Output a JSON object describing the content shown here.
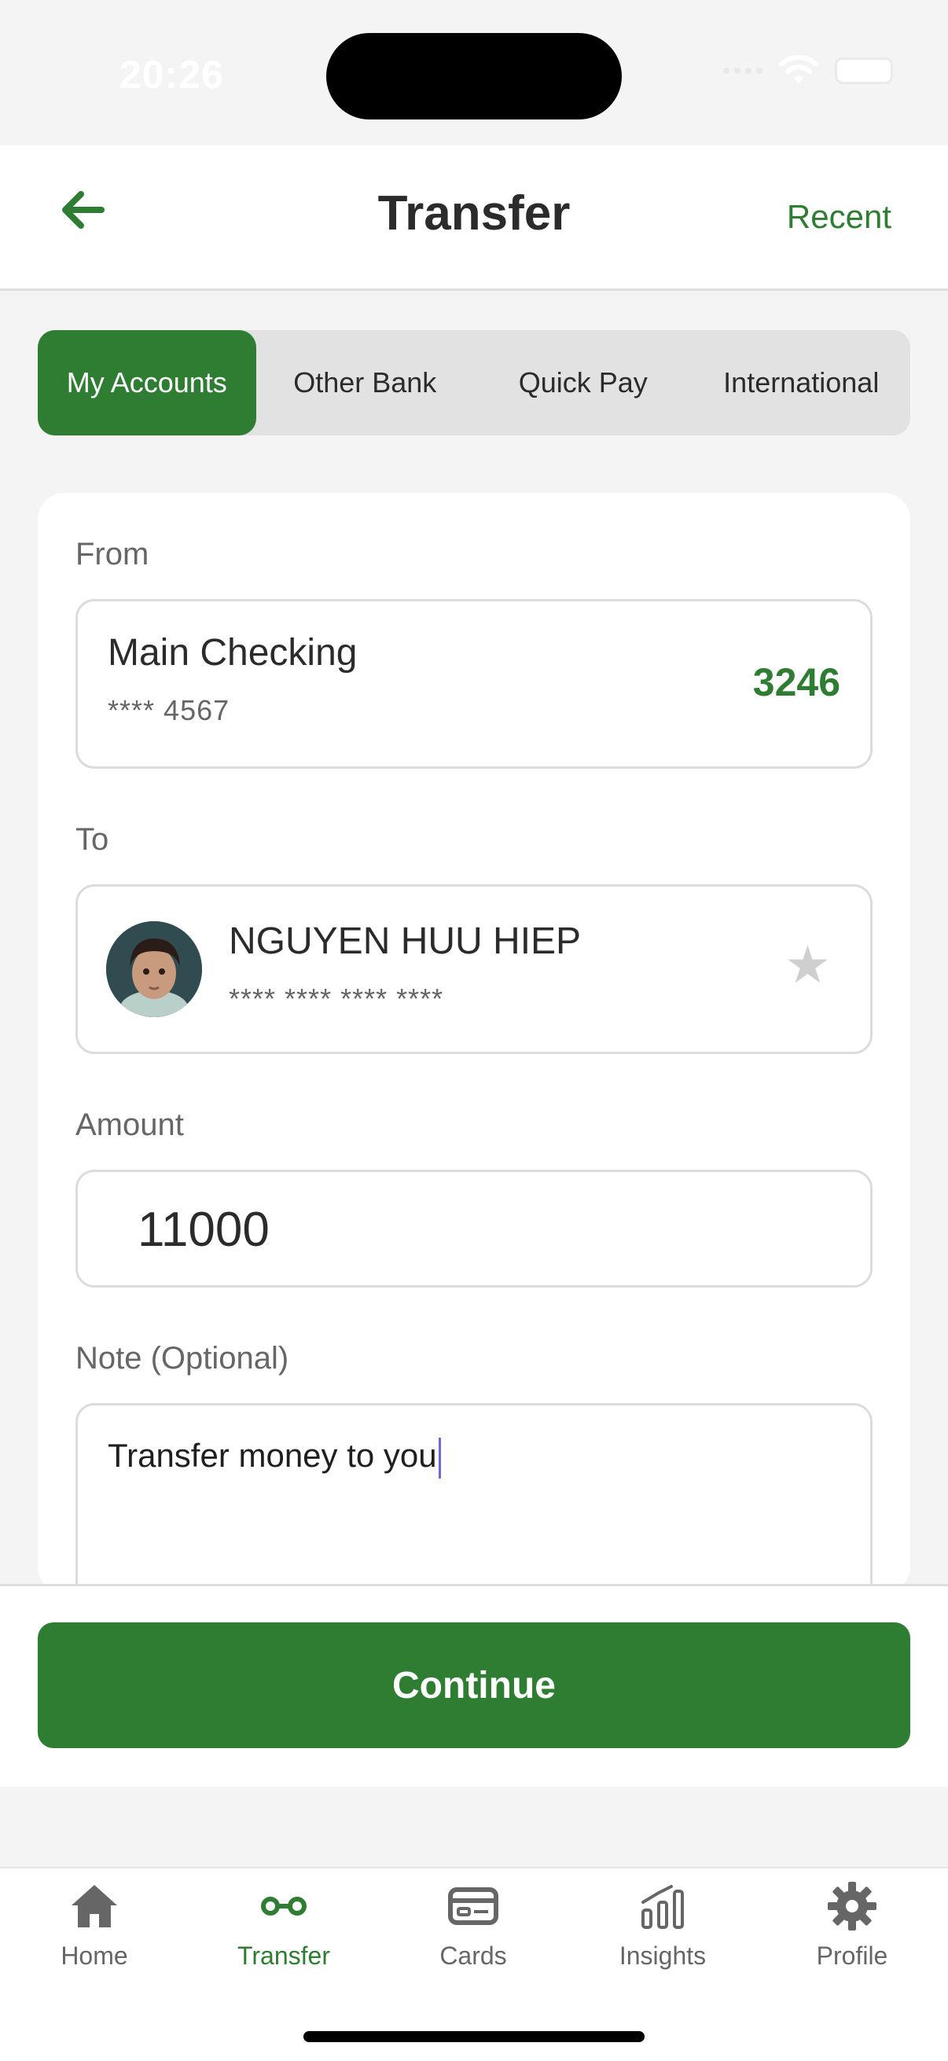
{
  "status_bar": {
    "time": "20:26"
  },
  "header": {
    "title": "Transfer",
    "recent_label": "Recent"
  },
  "tabs": [
    {
      "label": "My Accounts",
      "active": true
    },
    {
      "label": "Other Bank",
      "active": false
    },
    {
      "label": "Quick Pay",
      "active": false
    },
    {
      "label": "International",
      "active": false
    }
  ],
  "form": {
    "from_label": "From",
    "from_account": {
      "name": "Main Checking",
      "mask": "**** 4567",
      "balance": "3246"
    },
    "to_label": "To",
    "to_payee": {
      "name": "NGUYEN HUU HIEP",
      "mask": "**** **** **** ****"
    },
    "amount_label": "Amount",
    "amount_value": "11000",
    "note_label": "Note (Optional)",
    "note_value": "Transfer money to you"
  },
  "continue_label": "Continue",
  "bottom_nav": [
    {
      "label": "Home",
      "icon": "home-icon",
      "active": false
    },
    {
      "label": "Transfer",
      "icon": "transfer-icon",
      "active": true
    },
    {
      "label": "Cards",
      "icon": "card-icon",
      "active": false
    },
    {
      "label": "Insights",
      "icon": "chart-icon",
      "active": false
    },
    {
      "label": "Profile",
      "icon": "gear-icon",
      "active": false
    }
  ],
  "colors": {
    "accent": "#2e7d32",
    "background": "#f4f4f4",
    "inactive": "#666666"
  }
}
